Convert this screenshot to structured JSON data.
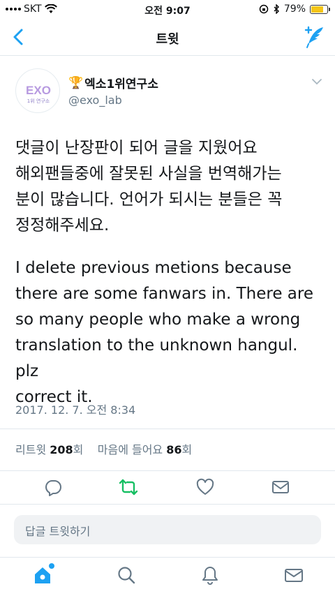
{
  "status": {
    "carrier": "SKT",
    "time": "오전 9:07",
    "battery": "79%",
    "battery_level": 0.79
  },
  "nav": {
    "title": "트윗",
    "back_icon": "chevron-left-icon",
    "compose_icon": "compose-feather-icon"
  },
  "tweet": {
    "user_name": "엑소1위연구소",
    "name_emoji": "🏆",
    "handle": "@exo_lab",
    "avatar_text_top": "EXO",
    "avatar_text_bottom": "1위 연구소",
    "text_ko": "댓글이 난장판이 되어 글을 지웠어요\n해외팬들중에 잘못된 사실을 번역해가는\n분이 많습니다. 언어가 되시는 분들은 꼭\n정정해주세요.",
    "text_en": "I delete previous metions because\nthere are some fanwars in. There are\nso many people who make a wrong\ntranslation to the unknown hangul. plz\ncorrect it.",
    "timestamp": "2017. 12. 7. 오전 8:34"
  },
  "stats": {
    "retweet_label": "리트윗",
    "retweet_count": "208",
    "retweet_unit": "회",
    "like_label": "마음에 들어요",
    "like_count": "86",
    "like_unit": "회"
  },
  "actions": [
    "reply-icon",
    "retweet-icon",
    "like-heart-icon",
    "message-icon"
  ],
  "reply": {
    "placeholder": "답글 트윗하기"
  },
  "tabs": [
    "home-icon",
    "search-icon",
    "notifications-bell-icon",
    "messages-icon"
  ],
  "colors": {
    "accent": "#1da1f2",
    "retweet_green": "#17bf63",
    "text": "#14171a",
    "muted": "#657786"
  }
}
